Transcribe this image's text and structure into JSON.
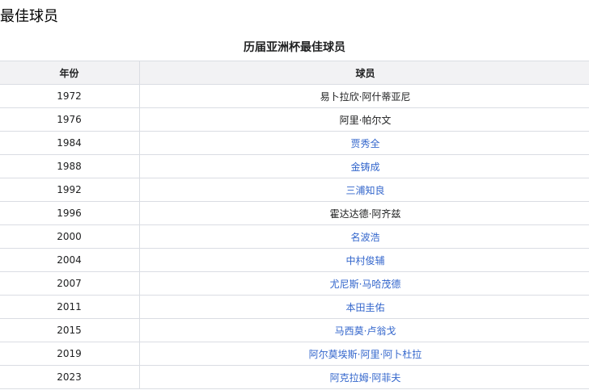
{
  "heading": "最佳球员",
  "table": {
    "caption": "历届亚洲杯最佳球员",
    "headers": {
      "year": "年份",
      "player": "球员"
    },
    "link_color": "#3366cc",
    "rows": [
      {
        "year": "1972",
        "player": "易卜拉欣·阿什蒂亚尼",
        "link": false
      },
      {
        "year": "1976",
        "player": "阿里·帕尔文",
        "link": false
      },
      {
        "year": "1984",
        "player": "贾秀全",
        "link": true
      },
      {
        "year": "1988",
        "player": "金铸成",
        "link": true
      },
      {
        "year": "1992",
        "player": "三浦知良",
        "link": true
      },
      {
        "year": "1996",
        "player": "霍达达德·阿齐兹",
        "link": false
      },
      {
        "year": "2000",
        "player": "名波浩",
        "link": true
      },
      {
        "year": "2004",
        "player": "中村俊辅",
        "link": true
      },
      {
        "year": "2007",
        "player": "尤尼斯·马哈茂德",
        "link": true
      },
      {
        "year": "2011",
        "player": "本田圭佑",
        "link": true
      },
      {
        "year": "2015",
        "player": "马西莫·卢翁戈",
        "link": true
      },
      {
        "year": "2019",
        "player": "阿尔莫埃斯·阿里·阿卜杜拉",
        "link": true
      },
      {
        "year": "2023",
        "player": "阿克拉姆·阿菲夫",
        "link": true
      }
    ]
  }
}
